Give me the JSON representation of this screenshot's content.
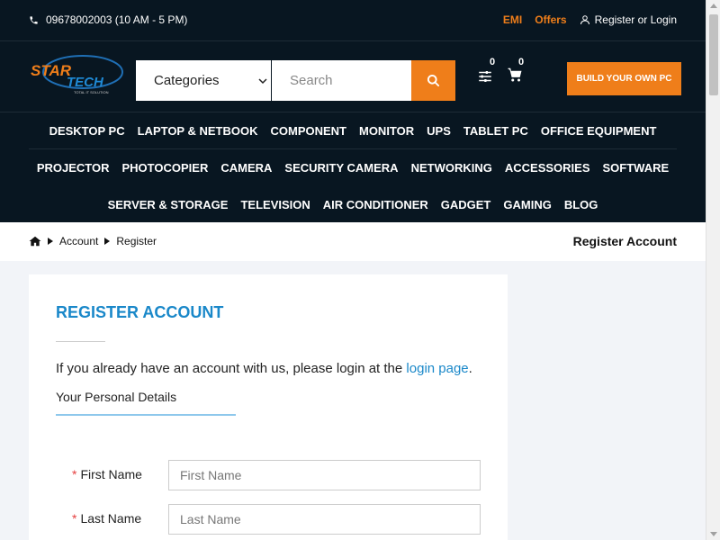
{
  "topbar": {
    "phone": "09678002003 (10 AM - 5 PM)",
    "links": {
      "emi": "EMI",
      "offers": "Offers",
      "login": "Register or Login"
    }
  },
  "header": {
    "logo_text_1": "STAR",
    "logo_text_2": "TECH",
    "logo_tagline": "TOTAL IT SOLUTION",
    "categories_label": "Categories",
    "search_placeholder": "Search",
    "compare_count": "0",
    "cart_count": "0",
    "build_button": "BUILD YOUR OWN PC"
  },
  "nav": {
    "row1": [
      "DESKTOP PC",
      "LAPTOP & NETBOOK",
      "COMPONENT",
      "MONITOR",
      "UPS",
      "TABLET PC",
      "OFFICE EQUIPMENT"
    ],
    "row2": [
      "PROJECTOR",
      "PHOTOCOPIER",
      "CAMERA",
      "SECURITY CAMERA",
      "NETWORKING",
      "ACCESSORIES",
      "SOFTWARE"
    ],
    "row3": [
      "SERVER & STORAGE",
      "TELEVISION",
      "AIR CONDITIONER",
      "GADGET",
      "GAMING",
      "BLOG"
    ]
  },
  "breadcrumb": {
    "items": [
      "Account",
      "Register"
    ],
    "page_heading": "Register Account"
  },
  "form": {
    "title": "REGISTER ACCOUNT",
    "intro_prefix": "If you already have an account with us, please login at the ",
    "intro_link": "login page",
    "intro_suffix": ".",
    "section_title": "Your Personal Details",
    "fields": [
      {
        "label": "First Name",
        "placeholder": "First Name",
        "required_mark": "*"
      },
      {
        "label": "Last Name",
        "placeholder": "Last Name",
        "required_mark": "*"
      }
    ]
  },
  "colors": {
    "dark_bg": "#081621",
    "accent_orange": "#ef7e1a",
    "link_blue": "#1a88c9"
  }
}
